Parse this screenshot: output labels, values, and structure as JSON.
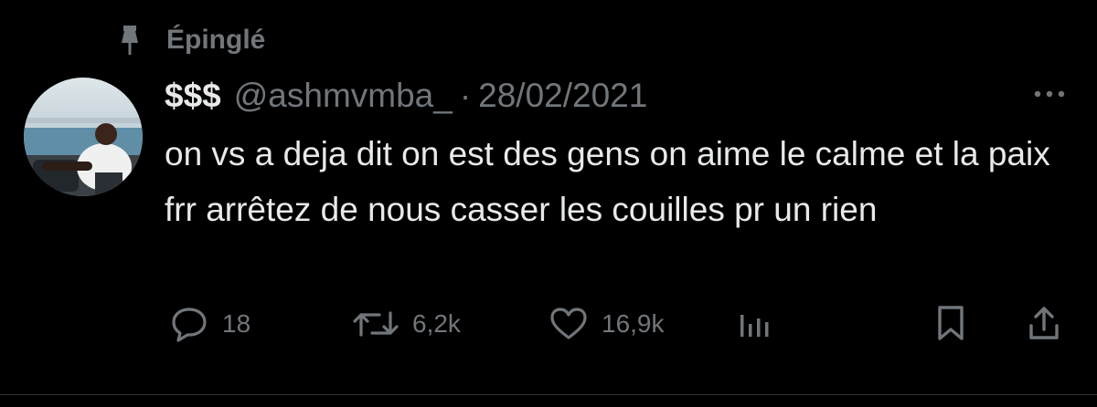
{
  "pinned": {
    "label": "Épinglé",
    "icon": "pin-icon"
  },
  "tweet": {
    "display_name": "$$$",
    "handle": "@ashmvmba_",
    "separator": "·",
    "date": "28/02/2021",
    "text": "on vs a deja dit on est des gens on aime le calme et la paix frr arrêtez de nous casser les couilles pr un rien"
  },
  "actions": {
    "replies": {
      "icon": "reply-icon",
      "count": "18"
    },
    "retweets": {
      "icon": "retweet-icon",
      "count": "6,2k"
    },
    "likes": {
      "icon": "heart-icon",
      "count": "16,9k"
    },
    "views": {
      "icon": "analytics-icon"
    },
    "bookmark": {
      "icon": "bookmark-icon"
    },
    "share": {
      "icon": "share-icon"
    }
  },
  "colors": {
    "background": "#000000",
    "text": "#e7e9ea",
    "muted": "#71767b"
  }
}
